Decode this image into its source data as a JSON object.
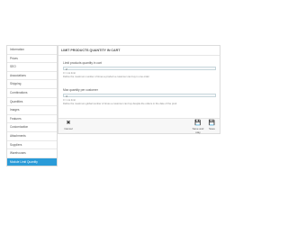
{
  "sidebar": {
    "items": [
      {
        "label": "Information"
      },
      {
        "label": "Prices"
      },
      {
        "label": "SEO"
      },
      {
        "label": "Associations"
      },
      {
        "label": "Shipping"
      },
      {
        "label": "Combinations"
      },
      {
        "label": "Quantities"
      },
      {
        "label": "Images"
      },
      {
        "label": "Features"
      },
      {
        "label": "Customization"
      },
      {
        "label": "Attachments"
      },
      {
        "label": "Suppliers"
      },
      {
        "label": "Warehouses"
      },
      {
        "label": "Module Limit Quantity"
      }
    ]
  },
  "panel": {
    "title": "LIMIT PRODUCTS QUANTITY IN CART",
    "min_qty": {
      "label": "Limit products quantity in cart",
      "value": "2",
      "hint": "0 = not limit",
      "hint2": "Define the maximum number of times a product a customer can buy in one order"
    },
    "max_qty": {
      "label": "Max quantity per customer",
      "value": "4",
      "hint": "0 = not limit",
      "hint2": "Define the maximum global number of times a customer can buy despite the orders or the date of the prod"
    },
    "cancel_label": "Cancel",
    "save_stay_label": "Save and stay",
    "save_label": "Save"
  }
}
